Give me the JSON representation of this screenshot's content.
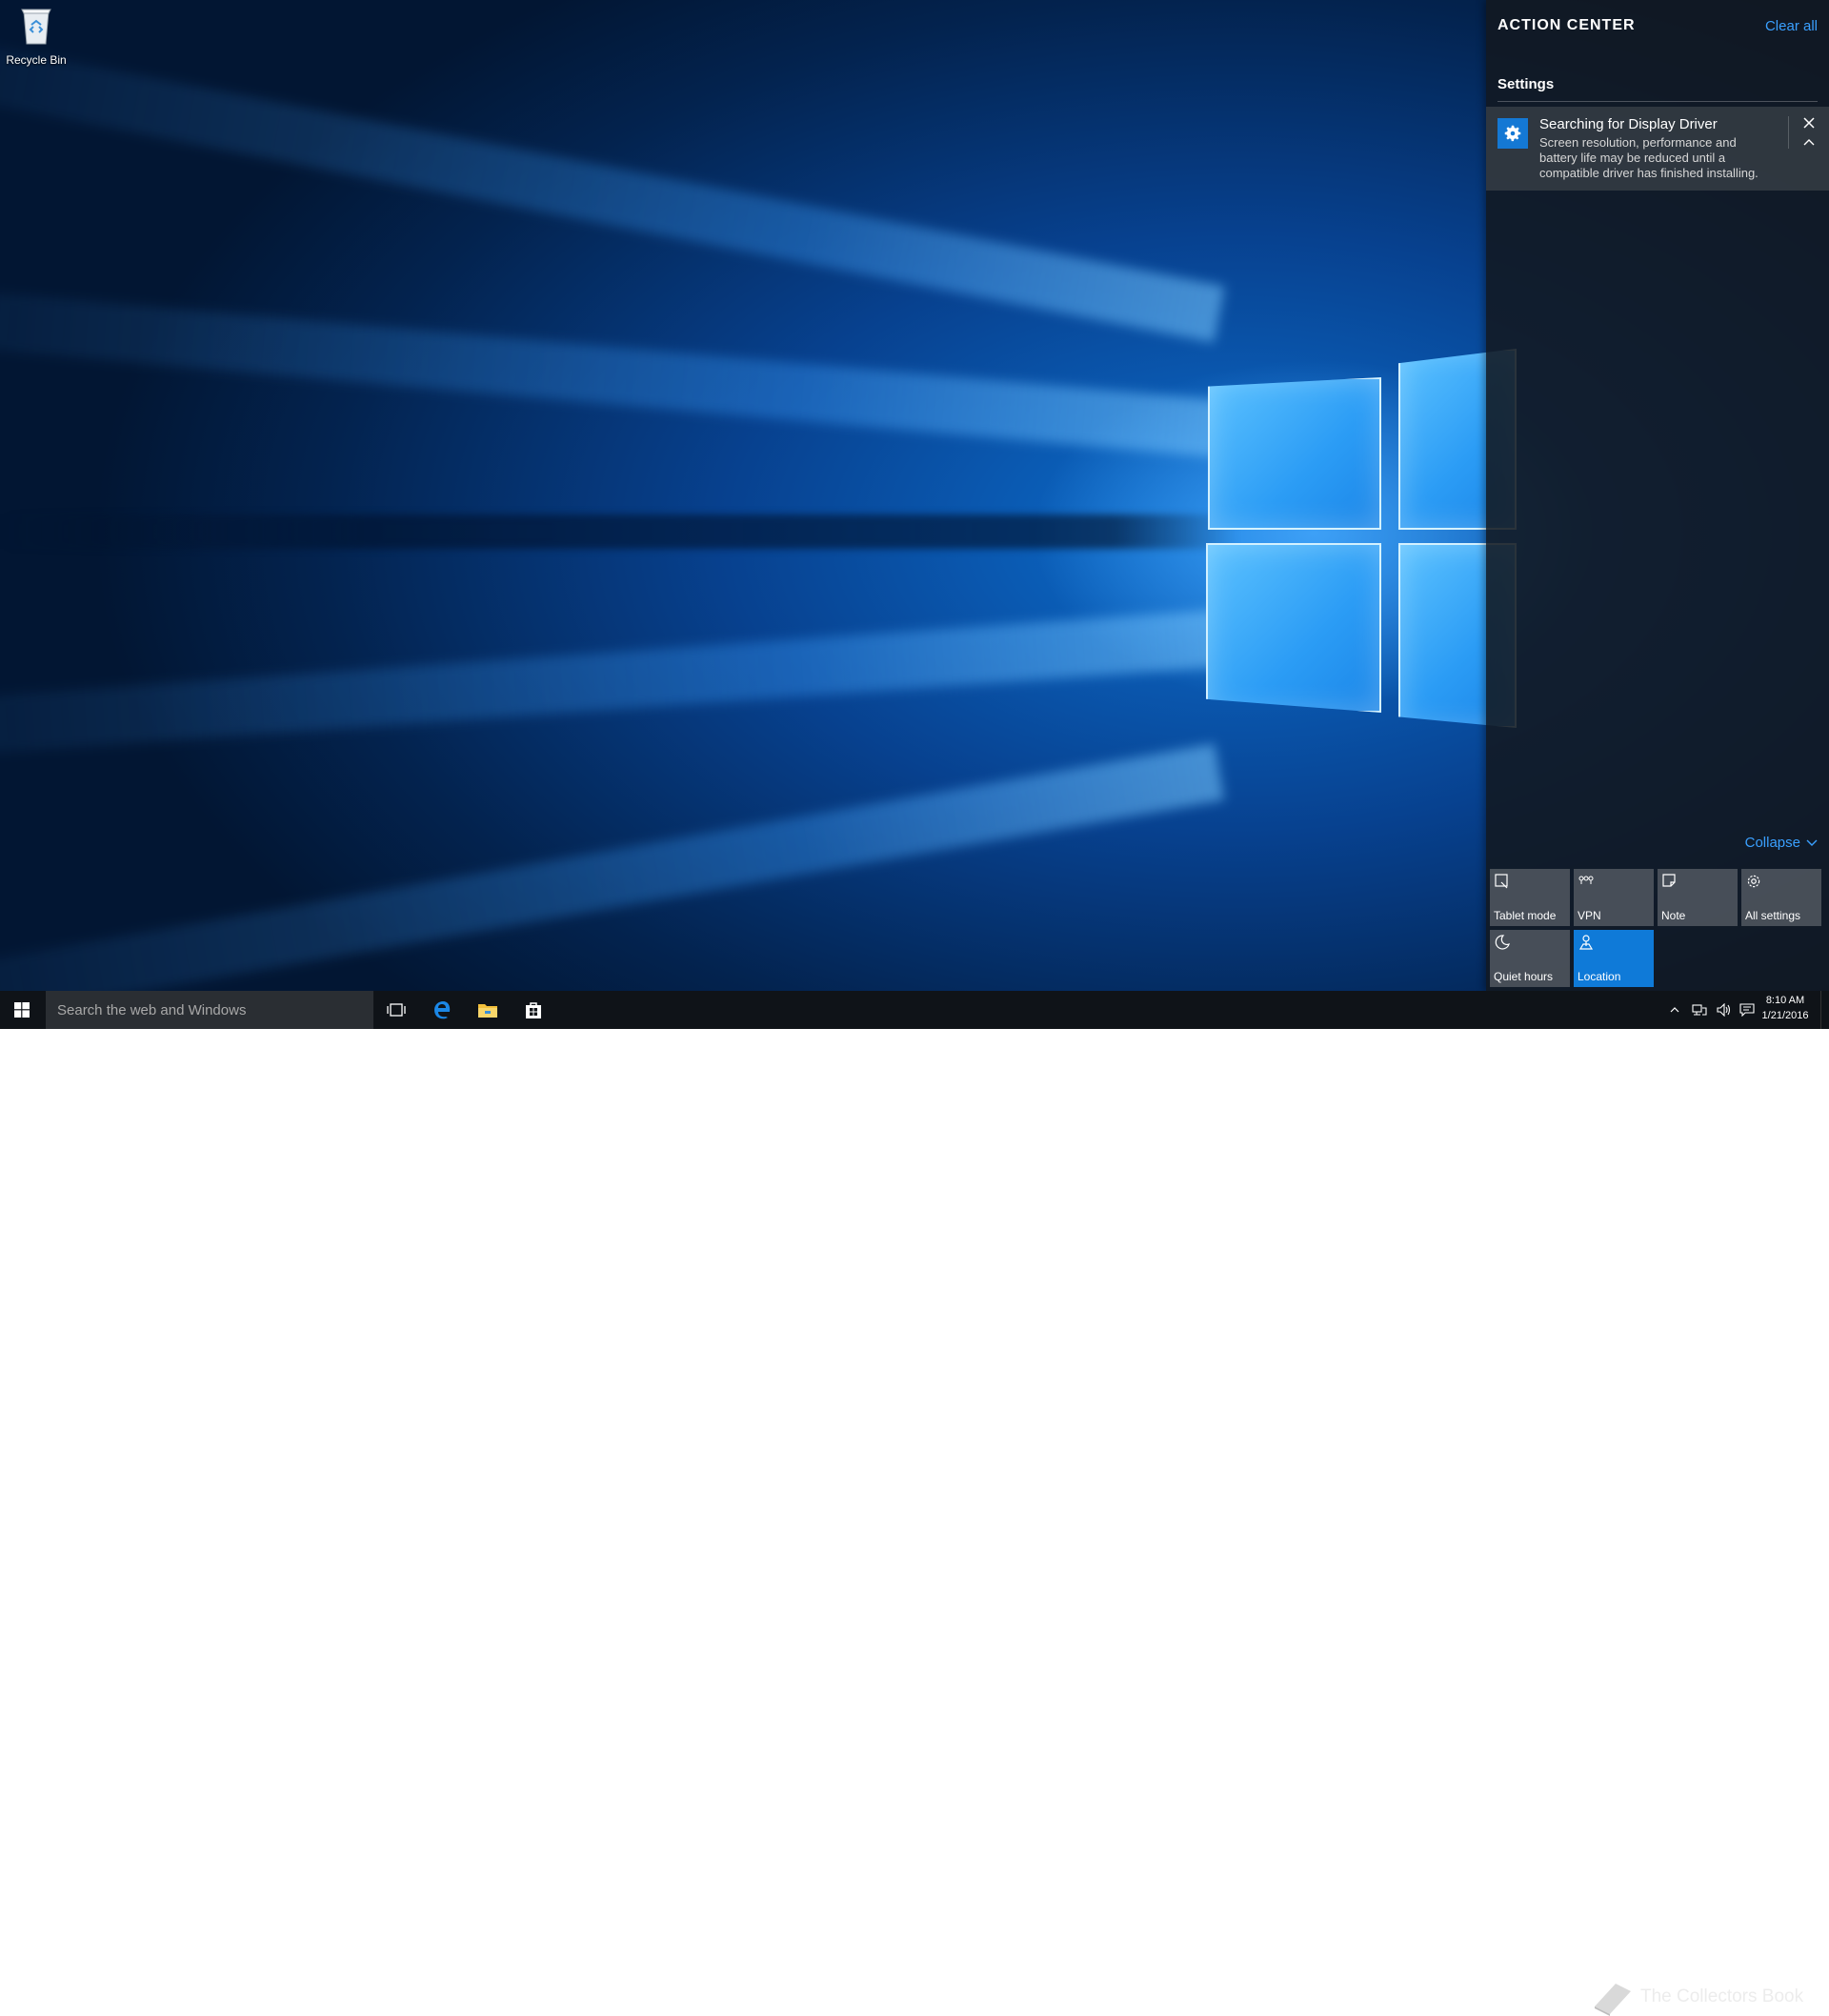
{
  "desktop": {
    "icons": [
      {
        "label": "Recycle Bin",
        "icon": "recycle-bin-icon"
      }
    ]
  },
  "action_center": {
    "title": "ACTION CENTER",
    "clear_all_label": "Clear all",
    "groups": [
      {
        "name": "Settings",
        "notifications": [
          {
            "icon": "gear-icon",
            "title": "Searching for Display Driver",
            "body": "Screen resolution, performance and battery life may be reduced until a compatible driver has finished installing."
          }
        ]
      }
    ],
    "collapse_label": "Collapse",
    "quick_actions": [
      {
        "label": "Tablet mode",
        "icon": "tablet-mode-icon",
        "active": false
      },
      {
        "label": "VPN",
        "icon": "vpn-icon",
        "active": false
      },
      {
        "label": "Note",
        "icon": "note-icon",
        "active": false
      },
      {
        "label": "All settings",
        "icon": "gear-icon",
        "active": false
      },
      {
        "label": "Quiet hours",
        "icon": "moon-icon",
        "active": false
      },
      {
        "label": "Location",
        "icon": "location-icon",
        "active": true
      }
    ],
    "colors": {
      "accent": "#3aa0ff",
      "active_tile": "#0f7ad8"
    }
  },
  "taskbar": {
    "search_placeholder": "Search the web and Windows",
    "pinned": [
      {
        "name": "Task View",
        "icon": "task-view-icon"
      },
      {
        "name": "Microsoft Edge",
        "icon": "edge-icon"
      },
      {
        "name": "File Explorer",
        "icon": "folder-icon"
      },
      {
        "name": "Store",
        "icon": "store-icon"
      }
    ],
    "tray": {
      "icons": [
        "chevron-up-icon",
        "network-icon",
        "volume-icon",
        "action-center-icon"
      ],
      "time": "8:10 AM",
      "date": "1/21/2016"
    },
    "watermark": "The Collectors Book"
  }
}
